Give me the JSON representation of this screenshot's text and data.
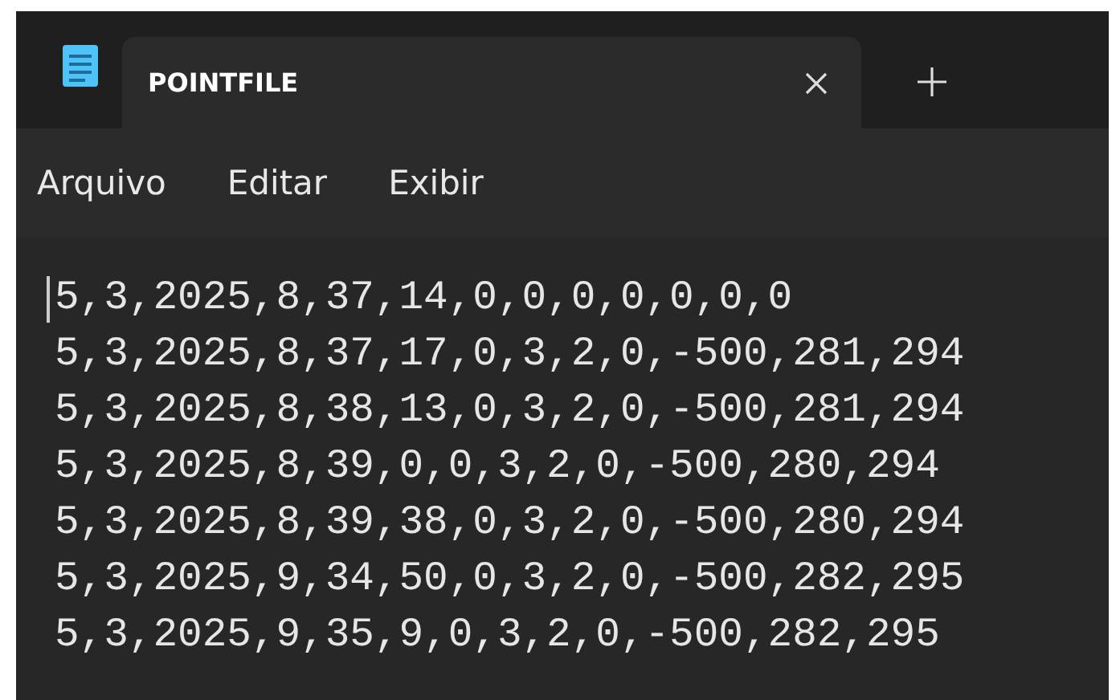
{
  "window": {
    "tabs": [
      {
        "title": "POINTFILE",
        "selected": true
      }
    ]
  },
  "menu": [
    "Arquivo",
    "Editar",
    "Exibir"
  ],
  "editor": {
    "lines": [
      "5,3,2025,8,37,14,0,0,0,0,0,0,0",
      "5,3,2025,8,37,17,0,3,2,0,-500,281,294",
      "5,3,2025,8,38,13,0,3,2,0,-500,281,294",
      "5,3,2025,8,39,0,0,3,2,0,-500,280,294",
      "5,3,2025,8,39,38,0,3,2,0,-500,280,294",
      "5,3,2025,9,34,50,0,3,2,0,-500,282,295",
      "5,3,2025,9,35,9,0,3,2,0,-500,282,295"
    ]
  }
}
